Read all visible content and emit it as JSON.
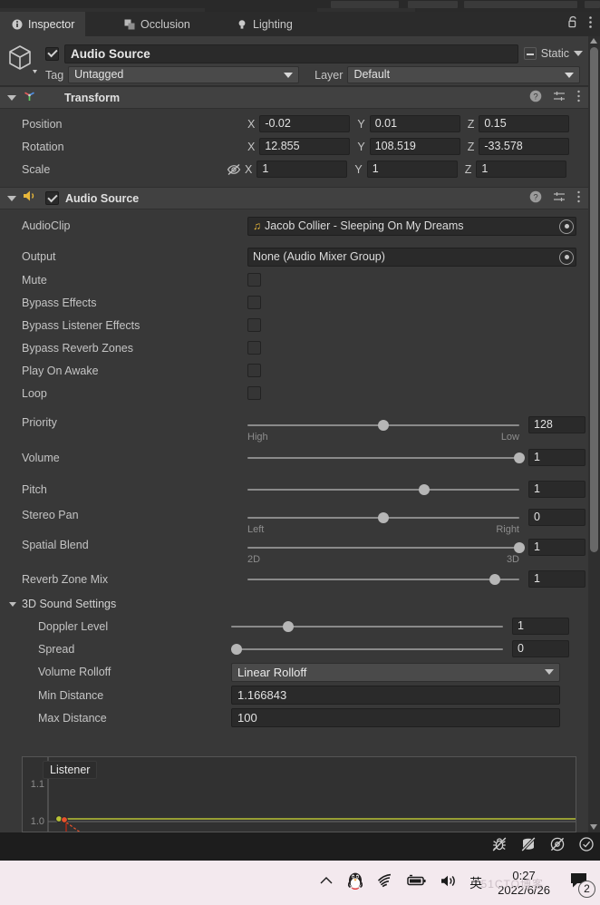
{
  "tabs": [
    {
      "label": "Inspector",
      "icon": "info-icon",
      "active": true
    },
    {
      "label": "Occlusion",
      "icon": "occlusion-icon",
      "active": false
    },
    {
      "label": "Lighting",
      "icon": "lightbulb-icon",
      "active": false
    }
  ],
  "tabbar_icons": {
    "lock": "unlock-icon",
    "menu": "kebab-menu-icon"
  },
  "object_header": {
    "enabled_checkbox": true,
    "name": "Audio Source",
    "static_label": "Static",
    "tag_label": "Tag",
    "tag_value": "Untagged",
    "layer_label": "Layer",
    "layer_value": "Default",
    "prefab_icon": "cube-icon"
  },
  "transform": {
    "title": "Transform",
    "icon": "transform-axis-icon",
    "rows": [
      {
        "label": "Position",
        "x": "-0.02",
        "y": "0.01",
        "z": "0.15",
        "locked": false
      },
      {
        "label": "Rotation",
        "x": "12.855",
        "y": "108.519",
        "z": "-33.578",
        "locked": false
      },
      {
        "label": "Scale",
        "x": "1",
        "y": "1",
        "z": "1",
        "locked": true
      }
    ],
    "axes": [
      "X",
      "Y",
      "Z"
    ],
    "header_icons": [
      "help-icon",
      "preset-icon",
      "kebab-menu-icon"
    ]
  },
  "audio_source": {
    "title": "Audio Source",
    "icon": "speaker-icon",
    "enabled_checkbox": true,
    "header_icons": [
      "help-icon",
      "preset-icon",
      "kebab-menu-icon"
    ],
    "audioclip": {
      "label": "AudioClip",
      "value": "Jacob Collier - Sleeping On My Dreams",
      "icon": "music-note-icon"
    },
    "output": {
      "label": "Output",
      "value": "None (Audio Mixer Group)"
    },
    "toggles": [
      {
        "label": "Mute",
        "checked": false
      },
      {
        "label": "Bypass Effects",
        "checked": false
      },
      {
        "label": "Bypass Listener Effects",
        "checked": false
      },
      {
        "label": "Bypass Reverb Zones",
        "checked": false
      },
      {
        "label": "Play On Awake",
        "checked": false
      },
      {
        "label": "Loop",
        "checked": false
      }
    ],
    "sliders": [
      {
        "label": "Priority",
        "value": "128",
        "percent": 50,
        "left_end": "High",
        "right_end": "Low"
      },
      {
        "label": "Volume",
        "value": "1",
        "percent": 100,
        "left_end": "",
        "right_end": ""
      },
      {
        "label": "Pitch",
        "value": "1",
        "percent": 65,
        "left_end": "",
        "right_end": ""
      },
      {
        "label": "Stereo Pan",
        "value": "0",
        "percent": 50,
        "left_end": "Left",
        "right_end": "Right"
      },
      {
        "label": "Spatial Blend",
        "value": "1",
        "percent": 100,
        "left_end": "2D",
        "right_end": "3D"
      },
      {
        "label": "Reverb Zone Mix",
        "value": "1",
        "percent": 91,
        "left_end": "",
        "right_end": ""
      }
    ]
  },
  "sound3d": {
    "title": "3D Sound Settings",
    "sliders": [
      {
        "label": "Doppler Level",
        "value": "1",
        "percent": 21
      },
      {
        "label": "Spread",
        "value": "0",
        "percent": 2
      }
    ],
    "rolloff": {
      "label": "Volume Rolloff",
      "value": "Linear Rolloff"
    },
    "min_distance": {
      "label": "Min Distance",
      "value": "1.166843"
    },
    "max_distance": {
      "label": "Max Distance",
      "value": "100"
    },
    "graph": {
      "tooltip": "Listener",
      "y_ticks": [
        "1.1",
        "1.0"
      ],
      "curve_color": "#b9c335",
      "rolloff_color": "#e8522b"
    }
  },
  "status_bar": {
    "icons": [
      "bug-off-icon",
      "stack-off-icon",
      "eye-off-icon",
      "check-circle-icon"
    ]
  },
  "taskbar": {
    "chevron": "chevron-up-icon",
    "tray_icons": [
      "qq-penguin-icon",
      "wifi-icon",
      "battery-icon",
      "volume-icon"
    ],
    "ime_label": "英",
    "time": "0:27",
    "date": "2022/6/26",
    "notification_icon": "notification-icon",
    "notification_count": "2",
    "watermark": "51CTO博客"
  },
  "colors": {
    "panel_bg": "#383838",
    "header_bg": "#414141",
    "field_bg": "#2a2a2a",
    "text": "#c4c4c4",
    "accent_yellow": "#e8b73a"
  }
}
